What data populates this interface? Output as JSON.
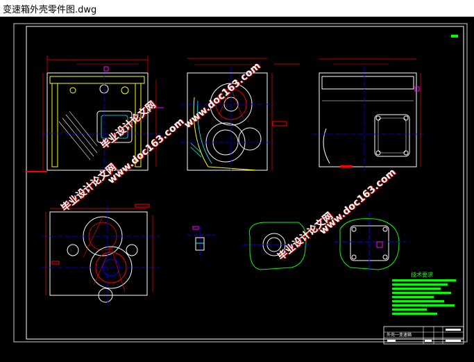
{
  "window": {
    "title": "变速箱外壳零件图.dwg"
  },
  "drawing": {
    "background": "#000000",
    "colors": {
      "frame": "#ffffff",
      "outline": "#ffffff",
      "dimension": "#ff0000",
      "center": "#0000ff",
      "hidden": "#00ffff",
      "yellow": "#ffff00",
      "green": "#00ff00",
      "magenta": "#ff00ff",
      "watermark": "#ffffff",
      "watermark_shadow": "#ff0000"
    },
    "watermarks": [
      {
        "text": "毕业设计论文网"
      },
      {
        "text": "www.doc163.com"
      },
      {
        "text": "毕业设计论文网"
      },
      {
        "text": "www.doc163.com"
      },
      {
        "text": "毕业设计论文网"
      },
      {
        "text": "www.doc163.com"
      }
    ],
    "notes_title": "技术要求",
    "title_block": {
      "part_name": "外壳一变速箱"
    }
  }
}
